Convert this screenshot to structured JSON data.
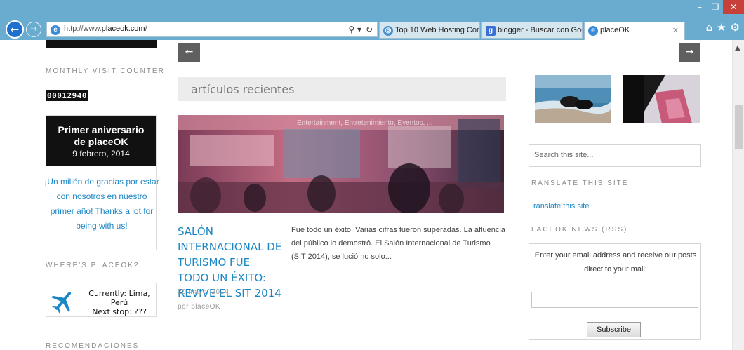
{
  "browser": {
    "url_prefix": "http://www.",
    "url_domain": "placeok.com",
    "url_suffix": "/",
    "tabs": [
      {
        "label": "Top 10 Web Hosting Com..."
      },
      {
        "label": "blogger - Buscar con Goo..."
      },
      {
        "label": "placeOK"
      }
    ],
    "window_controls": {
      "minimize": "–",
      "maximize": "❐",
      "close": "✕"
    },
    "back": "←",
    "forward": "→",
    "search_glyph": "⚲ ▾",
    "refresh_glyph": "↻",
    "tab_close": "✕",
    "icons": {
      "home": "⌂",
      "favorites": "★",
      "tools": "⚙"
    }
  },
  "left": {
    "counter_heading": "MONTHLY VISIT COUNTER",
    "counter_value": "00012940",
    "anniversary": {
      "title_line1": "Primer aniversario",
      "title_line2": "de placeOK",
      "date": "9 febrero, 2014",
      "message": "¡Un millón de gracias por estar con nosotros en nuestro primer año! Thanks a lot for being with us!"
    },
    "where_heading": "WHERE'S PLACEOK?",
    "where": {
      "current": "Currently: Lima, Perú",
      "next": "Next stop: ???"
    },
    "recommendations_heading": "RECOMENDACIONES"
  },
  "center": {
    "prev_arrow": "←",
    "next_arrow": "→",
    "section_title": "artículos recientes",
    "post": {
      "categories": "Entertainment, Entretenimiento, Eventos, ...",
      "title": "SALÓN INTERNACIONAL DE TURISMO FUE TODO UN ÉXITO: REVIVE EL SIT 2014",
      "date": "20 mayo, 2014",
      "author": "por placeOK",
      "excerpt": "Fue todo un éxito. Varias cifras fueron superadas. La afluencia del público lo demostró. El Salón Internacional de Turismo (SIT 2014), se lució no solo..."
    }
  },
  "right": {
    "search_placeholder": "Search this site...",
    "translate_heading": "RANSLATE THIS SITE",
    "translate_link": "ranslate this site",
    "news_heading": "LACEOK NEWS (RSS)",
    "subscribe_text": "Enter your email address and receive our posts direct to your mail:",
    "subscribe_button": "Subscribe"
  },
  "colors": {
    "chrome": "#6aaccf",
    "link": "#1b86c4",
    "dark_box": "#111111",
    "close_button": "#c7403a"
  }
}
